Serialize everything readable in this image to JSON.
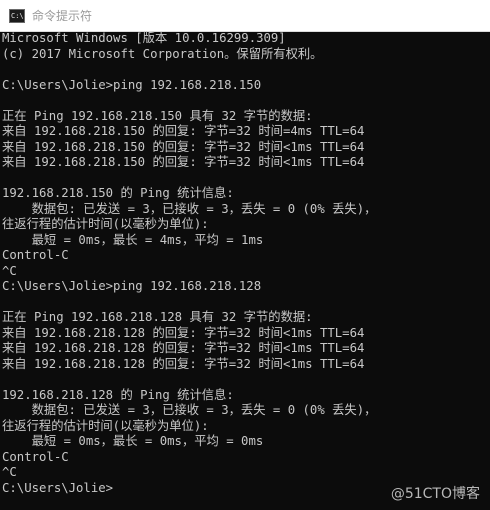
{
  "window": {
    "title": "命令提示符",
    "icon": "cmd-icon",
    "icon_label": "C:\\",
    "watermark": "@51CTO博客"
  },
  "console": {
    "lines": [
      "Microsoft Windows [版本 10.0.16299.309]",
      "(c) 2017 Microsoft Corporation。保留所有权利。",
      "",
      "C:\\Users\\Jolie>ping 192.168.218.150",
      "",
      "正在 Ping 192.168.218.150 具有 32 字节的数据:",
      "来自 192.168.218.150 的回复: 字节=32 时间=4ms TTL=64",
      "来自 192.168.218.150 的回复: 字节=32 时间<1ms TTL=64",
      "来自 192.168.218.150 的回复: 字节=32 时间<1ms TTL=64",
      "",
      "192.168.218.150 的 Ping 统计信息:",
      "    数据包: 已发送 = 3，已接收 = 3，丢失 = 0 (0% 丢失)，",
      "往返行程的估计时间(以毫秒为单位):",
      "    最短 = 0ms，最长 = 4ms，平均 = 1ms",
      "Control-C",
      "^C",
      "C:\\Users\\Jolie>ping 192.168.218.128",
      "",
      "正在 Ping 192.168.218.128 具有 32 字节的数据:",
      "来自 192.168.218.128 的回复: 字节=32 时间<1ms TTL=64",
      "来自 192.168.218.128 的回复: 字节=32 时间<1ms TTL=64",
      "来自 192.168.218.128 的回复: 字节=32 时间<1ms TTL=64",
      "",
      "192.168.218.128 的 Ping 统计信息:",
      "    数据包: 已发送 = 3，已接收 = 3，丢失 = 0 (0% 丢失)，",
      "往返行程的估计时间(以毫秒为单位):",
      "    最短 = 0ms，最长 = 0ms，平均 = 0ms",
      "Control-C",
      "^C",
      "C:\\Users\\Jolie>"
    ]
  }
}
